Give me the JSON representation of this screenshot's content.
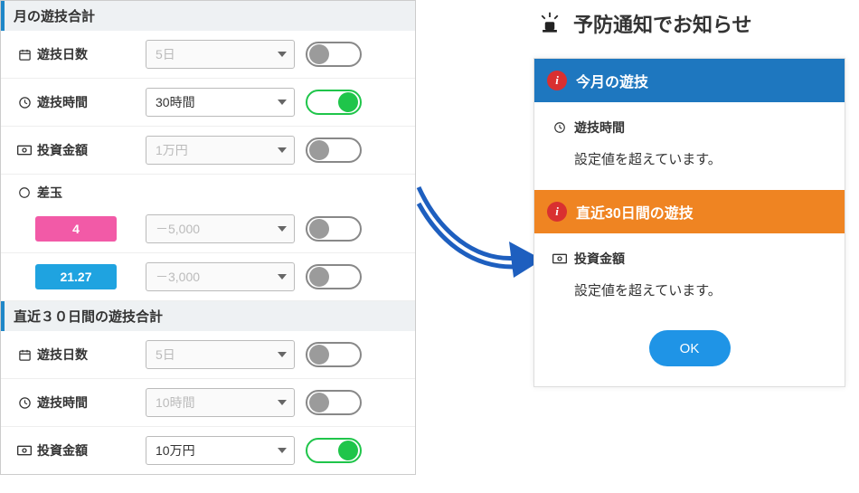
{
  "left": {
    "section1_title": "月の遊技合計",
    "section2_title": "直近３０日間の遊技合計",
    "rows": {
      "days": {
        "label": "遊技日数",
        "value": "5日",
        "enabled": false
      },
      "time": {
        "label": "遊技時間",
        "value": "30時間",
        "enabled": true
      },
      "money": {
        "label": "投資金額",
        "value": "1万円",
        "enabled": false
      },
      "balls": {
        "label": "差玉"
      },
      "chip1": {
        "chip": "4",
        "value": "－5,000",
        "enabled": false
      },
      "chip2": {
        "chip": "21.27",
        "value": "－3,000",
        "enabled": false
      }
    },
    "rows2": {
      "days": {
        "label": "遊技日数",
        "value": "5日",
        "enabled": false
      },
      "time": {
        "label": "遊技時間",
        "value": "10時間",
        "enabled": false
      },
      "money": {
        "label": "投資金額",
        "value": "10万円",
        "enabled": true
      }
    }
  },
  "right": {
    "title": "予防通知でお知らせ",
    "banner1": "今月の遊技",
    "notice1_label": "遊技時間",
    "notice1_msg": "設定値を超えています。",
    "banner2": "直近30日間の遊技",
    "notice2_label": "投資金額",
    "notice2_msg": "設定値を超えています。",
    "ok": "OK"
  }
}
